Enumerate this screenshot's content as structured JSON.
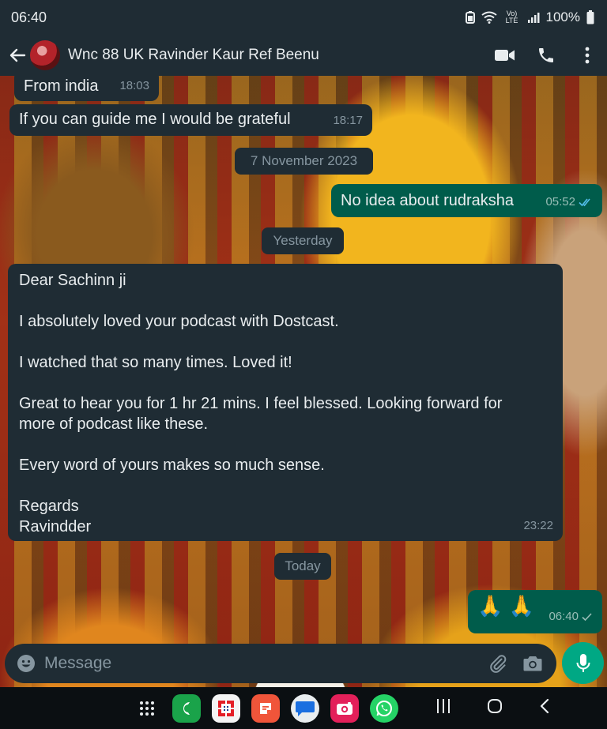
{
  "status_bar": {
    "time": "06:40",
    "battery": "100%",
    "network_label": "Vo) LTE"
  },
  "header": {
    "contact_name": "Wnc 88 UK Ravinder Kaur Ref Beenu",
    "icons": [
      "back-arrow-icon",
      "avatar",
      "video-call-icon",
      "phone-icon",
      "more-vert-icon"
    ]
  },
  "messages": {
    "m1": {
      "text": "From india",
      "time": "18:03",
      "direction": "incoming"
    },
    "m2": {
      "text": "If you can guide me I would be grateful",
      "time": "18:17",
      "direction": "incoming"
    },
    "date1": "7 November 2023",
    "m3": {
      "text": "No idea about rudraksha",
      "time": "05:52",
      "status": "read",
      "direction": "outgoing"
    },
    "date2": "Yesterday",
    "m4": {
      "direction": "incoming",
      "p1": "Dear Sachinn ji",
      "p2": "I absolutely loved your podcast with Dostcast.",
      "p3": "I watched that so many times. Loved it!",
      "p4a": "Great to hear you for 1 hr 21 mins. I feel blessed. Looking forward for",
      "p4b": "more of podcast like these.",
      "p5": "Every word of yours makes so much sense.",
      "p6a": "Regards",
      "p6b": "Ravindder",
      "time": "23:22"
    },
    "date3": "Today",
    "m5": {
      "text": "🙏 🙏",
      "time": "06:40",
      "status": "sent",
      "direction": "outgoing"
    }
  },
  "composer": {
    "placeholder": "Message",
    "icons": [
      "emoji-icon",
      "attach-icon",
      "camera-icon",
      "mic-icon"
    ]
  },
  "nav_bar": {
    "apps": [
      "app-drawer-icon",
      "phone-app-icon",
      "bank-app-icon",
      "notes-app-icon",
      "messages-app-icon",
      "camera-app-icon",
      "whatsapp-app-icon"
    ],
    "keys": [
      "recents-icon",
      "home-icon",
      "back-icon"
    ]
  },
  "colors": {
    "header_bg": "#1f2c34",
    "incoming_bubble": "#1f2c34",
    "outgoing_bubble": "#005c4b",
    "accent_green": "#00a884",
    "read_tick": "#53bdeb"
  }
}
